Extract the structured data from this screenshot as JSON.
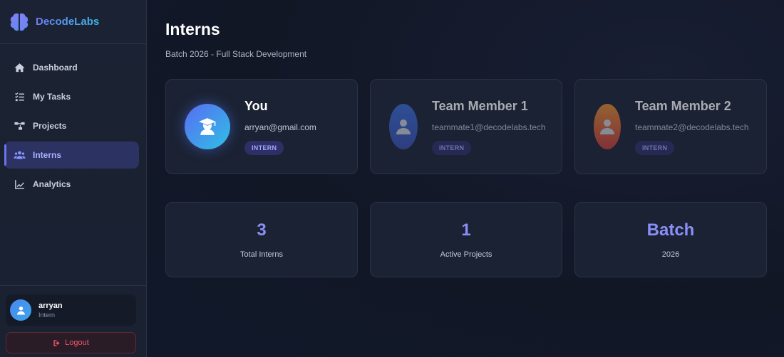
{
  "brand": {
    "name": "DecodeLabs",
    "icon": "brain-icon",
    "colors": [
      "#6e7df5",
      "#3ab6e8"
    ]
  },
  "sidebar": {
    "items": [
      {
        "label": "Dashboard",
        "icon": "home-icon",
        "active": false
      },
      {
        "label": "My Tasks",
        "icon": "task-list-icon",
        "active": false
      },
      {
        "label": "Projects",
        "icon": "project-tree-icon",
        "active": false
      },
      {
        "label": "Interns",
        "icon": "users-icon",
        "active": true
      },
      {
        "label": "Analytics",
        "icon": "line-chart-icon",
        "active": false
      }
    ],
    "user": {
      "name": "arryan",
      "role": "Intern",
      "icon": "user-icon"
    },
    "logout_label": "Logout"
  },
  "main": {
    "title": "Interns",
    "subtitle": "Batch 2026 - Full Stack Development",
    "members": [
      {
        "name": "You",
        "email": "arryan@gmail.com",
        "badge": "INTERN",
        "icon": "graduation-user-icon"
      },
      {
        "name": "Team Member 1",
        "email": "teammate1@decodelabs.tech",
        "badge": "INTERN",
        "icon": "user-icon"
      },
      {
        "name": "Team Member 2",
        "email": "teammate2@decodelabs.tech",
        "badge": "INTERN",
        "icon": "user-icon"
      }
    ],
    "stats": [
      {
        "value": "3",
        "label": "Total Interns"
      },
      {
        "value": "1",
        "label": "Active Projects"
      },
      {
        "value": "Batch",
        "label": "2026"
      }
    ]
  },
  "colors": {
    "accent": "#6b74f0",
    "stat_value": "#8a8ff7",
    "danger": "#f05a6a"
  }
}
